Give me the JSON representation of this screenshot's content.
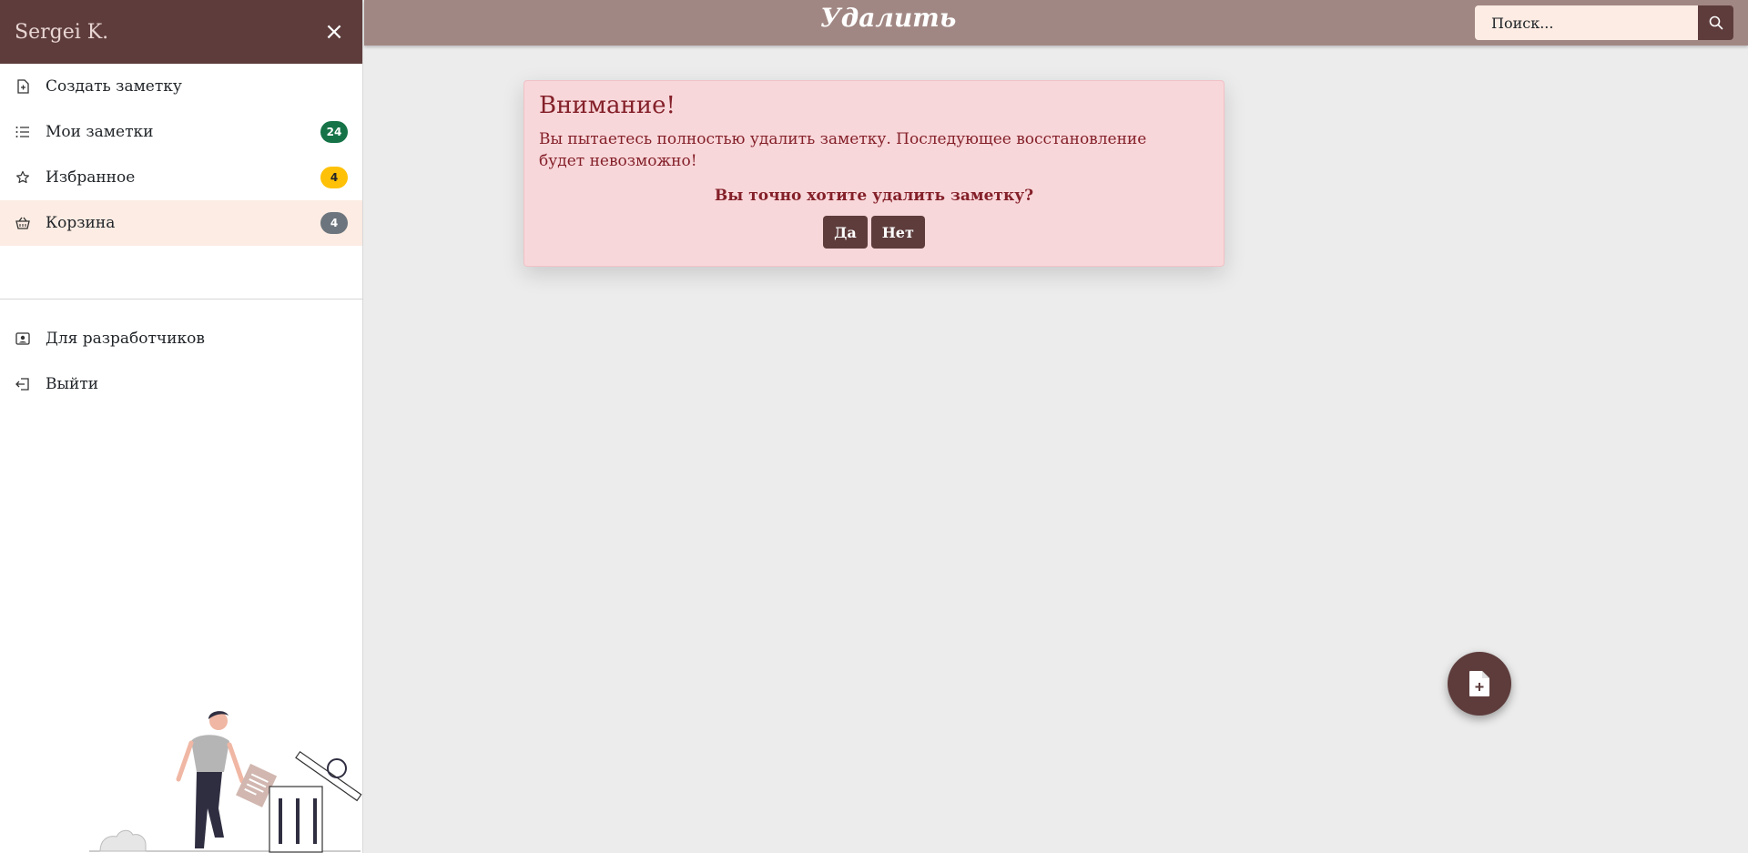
{
  "sidebar": {
    "user_name": "Sergei K.",
    "close_glyph": "×",
    "items": [
      {
        "label": "Создать заметку",
        "icon": "file-plus-icon"
      },
      {
        "label": "Мои заметки",
        "icon": "list-icon",
        "badge": "24",
        "badge_color": "#157347"
      },
      {
        "label": "Избранное",
        "icon": "star-icon",
        "badge": "4",
        "badge_color": "#ffc107"
      },
      {
        "label": "Корзина",
        "icon": "basket-icon",
        "badge": "4",
        "badge_color": "#6c757d",
        "active": true
      }
    ],
    "bottom_items": [
      {
        "label": "Для разработчиков",
        "icon": "person-badge-icon"
      },
      {
        "label": "Выйти",
        "icon": "box-arrow-left-icon"
      }
    ]
  },
  "topbar": {
    "title": "Удалить",
    "search": {
      "placeholder": "Поиск...",
      "value": ""
    }
  },
  "alert": {
    "title": "Внимание!",
    "message": "Вы пытаетесь полностью удалить заметку. Последующее восстановление будет невозможно!",
    "question": "Вы точно хотите удалить заметку?",
    "yes_label": "Да",
    "no_label": "Нет"
  },
  "colors": {
    "brand_dark": "#5e3c3c",
    "topbar": "#a18783",
    "active_item": "#fdece3",
    "alert_bg": "#f8d7da",
    "alert_text": "#842029",
    "background": "#ececec"
  },
  "fab": {
    "icon": "file-plus-icon"
  }
}
